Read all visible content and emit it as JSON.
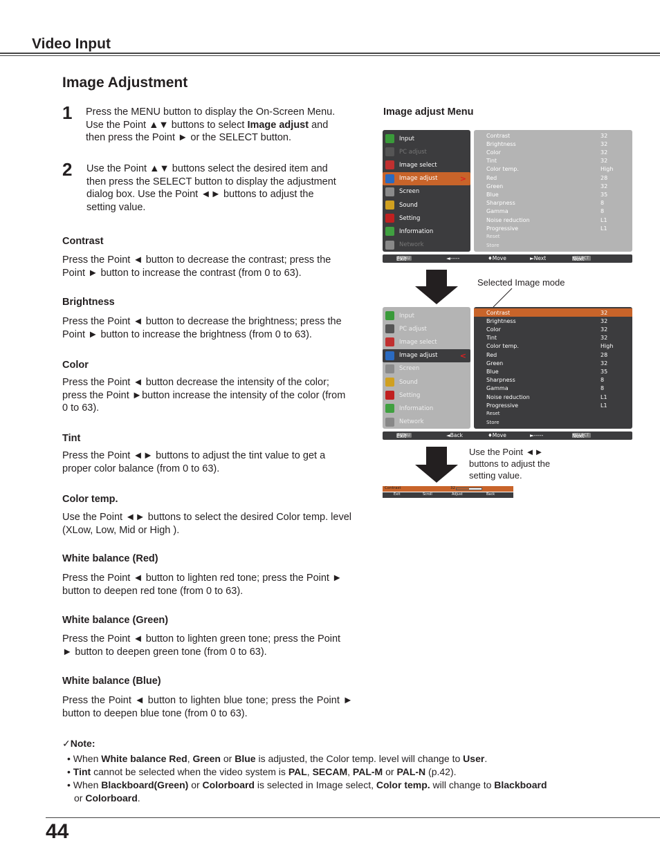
{
  "header": {
    "section_title": "Video Input"
  },
  "page": {
    "heading": "Image Adjustment",
    "number": "44"
  },
  "steps": [
    {
      "num": "1",
      "parts": [
        "Press the MENU button to display the On-Screen Menu. Use the Point ▲▼ buttons to select ",
        "Image adjust",
        " and then press the Point ► or the SELECT button."
      ]
    },
    {
      "num": "2",
      "text": "Use the Point ▲▼ buttons select the desired item and then press the SELECT button to display the adjustment dialog box. Use the Point ◄► buttons to adjust the setting value."
    }
  ],
  "items": [
    {
      "title": "Contrast",
      "text": "Press the Point ◄ button to decrease the contrast; press the Point ► button to increase the contrast (from 0 to 63)."
    },
    {
      "title": "Brightness",
      "text": "Press the Point ◄ button to decrease the brightness; press the Point ► button to increase the brightness (from 0 to 63)."
    },
    {
      "title": "Color",
      "text": "Press the Point ◄ button decrease the intensity of the color; press the Point ►button increase the intensity of the color (from 0 to 63)."
    },
    {
      "title": "Tint",
      "text": "Press the Point ◄► buttons to adjust the tint value to get a proper color balance (from 0 to 63)."
    },
    {
      "title": "Color temp.",
      "text": "Use the Point ◄► buttons to select the desired Color temp. level (XLow, Low, Mid or High )."
    },
    {
      "title": "White balance (Red)",
      "text": "Press the Point ◄ button to lighten red tone; press the Point ► button to deepen red tone (from 0 to 63)."
    },
    {
      "title": "White balance (Green)",
      "text": "Press the Point ◄ button to lighten green tone; press the Point ► button to deepen green tone (from 0 to 63)."
    },
    {
      "title": "White balance (Blue)",
      "text": "Press the Point ◄ button to lighten blue tone; press the Point ► button to deepen blue tone (from 0 to 63)."
    }
  ],
  "menu_figure": {
    "caption": "Image adjust Menu",
    "annotation_selected": "Selected Image mode",
    "annotation_adjust": "Use the Point ◄► buttons to adjust the setting value.",
    "main_menu": [
      "Input",
      "PC adjust",
      "Image select",
      "Image adjust",
      "Screen",
      "Sound",
      "Setting",
      "Information",
      "Network"
    ],
    "settings": [
      {
        "label": "Contrast",
        "value": "32"
      },
      {
        "label": "Brightness",
        "value": "32"
      },
      {
        "label": "Color",
        "value": "32"
      },
      {
        "label": "Tint",
        "value": "32"
      },
      {
        "label": "Color temp.",
        "value": "High"
      },
      {
        "label": "Red",
        "value": "28"
      },
      {
        "label": "Green",
        "value": "32"
      },
      {
        "label": "Blue",
        "value": "35"
      },
      {
        "label": "Sharpness",
        "value": "8"
      },
      {
        "label": "Gamma",
        "value": "8"
      },
      {
        "label": "Noise reduction",
        "value": "L1"
      },
      {
        "label": "Progressive",
        "value": "L1"
      }
    ],
    "reset_label": "Reset",
    "store_label": "Store",
    "bar1": {
      "menu_key": "MENU",
      "exit": "Exit",
      "left": "◄-----",
      "move": "♦Move",
      "right": "►Next",
      "select_key": "SELECT",
      "select": "Next"
    },
    "bar2": {
      "menu_key": "MENU",
      "exit": "Exit",
      "left": "◄Back",
      "move": "♦Move",
      "right": "►-----",
      "select_key": "SELECT",
      "select": "Next"
    },
    "dialog": {
      "label": "Contrast",
      "value": "32",
      "value_fraction": 0.5,
      "exit": "Exit",
      "scroll": "Scroll",
      "adjust": "Adjust",
      "back": "Back"
    }
  },
  "note": {
    "title": "Note:",
    "check": "✓",
    "bullets": [
      [
        [
          "When ",
          false
        ],
        [
          "White balance Red",
          true
        ],
        [
          ", ",
          false
        ],
        [
          "Green",
          true
        ],
        [
          " or ",
          false
        ],
        [
          "Blue",
          true
        ],
        [
          " is adjusted, the Color temp. level will change to ",
          false
        ],
        [
          "User",
          true
        ],
        [
          ".",
          false
        ]
      ],
      [
        [
          "Tint",
          true
        ],
        [
          " cannot be selected when the video system is ",
          false
        ],
        [
          "PAL",
          true
        ],
        [
          ", ",
          false
        ],
        [
          "SECAM",
          true
        ],
        [
          ", ",
          false
        ],
        [
          "PAL-M",
          true
        ],
        [
          " or ",
          false
        ],
        [
          "PAL-N",
          true
        ],
        [
          " (p.42).",
          false
        ]
      ],
      [
        [
          "When ",
          false
        ],
        [
          "Blackboard(Green)",
          true
        ],
        [
          " or ",
          false
        ],
        [
          "Colorboard",
          true
        ],
        [
          " is selected in Image select, ",
          false
        ],
        [
          "Color temp.",
          true
        ],
        [
          " will change to ",
          false
        ],
        [
          "Blackboard",
          true
        ],
        [
          " or ",
          false
        ],
        [
          "Colorboard",
          true
        ],
        [
          ".",
          false
        ]
      ]
    ]
  },
  "colors": {
    "accent": "#c8642a",
    "osd_dark": "#3c3c3e",
    "osd_light": "#b4b4b4"
  }
}
